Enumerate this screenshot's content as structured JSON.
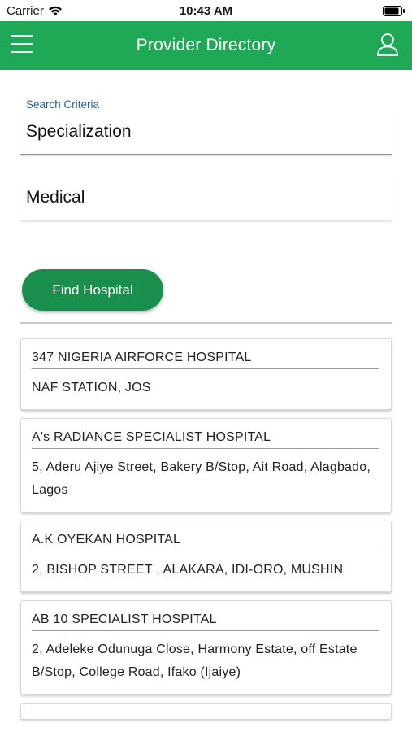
{
  "status_bar": {
    "carrier": "Carrier",
    "time": "10:43 AM"
  },
  "header": {
    "title": "Provider Directory",
    "menu_icon": "hamburger-menu-icon",
    "profile_icon": "user-profile-icon",
    "background_color": "#1fa855"
  },
  "search": {
    "label": "Search Criteria",
    "criteria_value": "Specialization",
    "category_value": "Medical",
    "button_label": "Find Hospital",
    "button_color": "#1a8f4d"
  },
  "results": [
    {
      "name": "347 NIGERIA AIRFORCE HOSPITAL",
      "address": "NAF STATION, JOS"
    },
    {
      "name": "A's RADIANCE SPECIALIST HOSPITAL",
      "address": "5, Aderu Ajiye Street, Bakery B/Stop, Ait Road, Alagbado, Lagos"
    },
    {
      "name": "A.K OYEKAN HOSPITAL",
      "address": "2, BISHOP STREET , ALAKARA, IDI-ORO, MUSHIN"
    },
    {
      "name": "AB 10 SPECIALIST HOSPITAL",
      "address": "2, Adeleke Odunuga Close, Harmony Estate, off Estate B/Stop, College Road, Ifako (Ijaiye)"
    }
  ]
}
